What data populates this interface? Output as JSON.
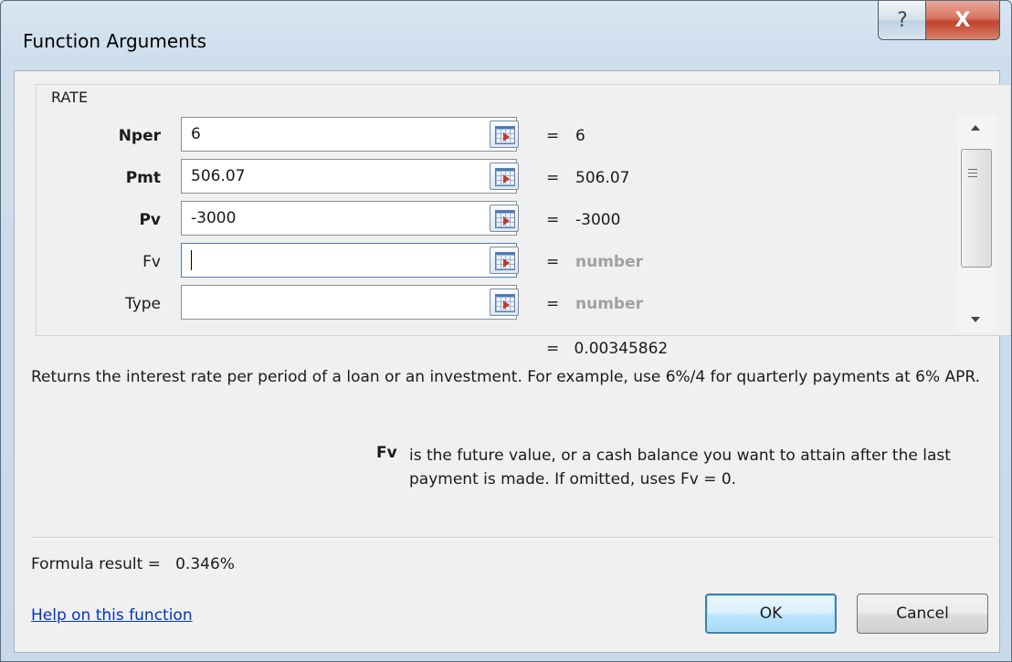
{
  "window": {
    "title": "Function Arguments",
    "help_glyph": "?",
    "close_glyph": "X"
  },
  "function": {
    "name": "RATE",
    "args": [
      {
        "label": "Nper",
        "bold": true,
        "value": "6",
        "evaluated": "6"
      },
      {
        "label": "Pmt",
        "bold": true,
        "value": "506.07",
        "evaluated": "506.07"
      },
      {
        "label": "Pv",
        "bold": true,
        "value": "-3000",
        "evaluated": "-3000"
      },
      {
        "label": "Fv",
        "bold": false,
        "value": "",
        "evaluated": "number"
      },
      {
        "label": "Type",
        "bold": false,
        "value": "",
        "evaluated": "number"
      }
    ],
    "equals_sign": "=",
    "result_value": "0.00345862",
    "description": "Returns the interest rate per period of a loan or an investment. For example, use 6%/4 for quarterly payments at 6% APR.",
    "arg_help_name": "Fv",
    "arg_help_text": "is the future value, or a cash balance you want to attain after the last payment is made. If omitted, uses Fv = 0."
  },
  "formula_result": {
    "label": "Formula result =",
    "value": "0.346%"
  },
  "footer": {
    "help_link": "Help on this function",
    "ok_label": "OK",
    "cancel_label": "Cancel"
  },
  "colors": {
    "link": "#0033cc",
    "placeholder": "#a0a0a0",
    "close_button": "#c1412c"
  }
}
